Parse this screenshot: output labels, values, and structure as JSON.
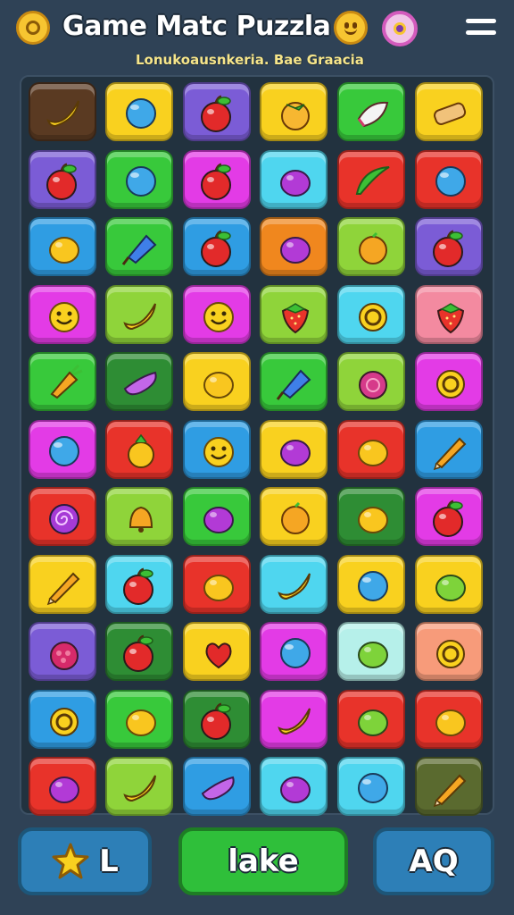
{
  "header": {
    "title": "Game  Matc Puzzla",
    "subtitle": "Lonukoausnkeria.  Bae  Graacia"
  },
  "buttons": {
    "left_label": "L",
    "middle_label": "lake",
    "right_label": "AQ"
  },
  "colors": {
    "red": "#e8332a",
    "green": "#38c93b",
    "blue": "#2f9de3",
    "yellow": "#f9d11f",
    "purple": "#7b5cd6",
    "magenta": "#e33be6",
    "orange": "#f0871e",
    "cyan": "#4fd6ef",
    "brown": "#5a3a22",
    "lime": "#8fd43a",
    "darkgreen": "#2e8d34",
    "pink": "#f38aa0",
    "lightcyan": "#b6f0ea",
    "salmon": "#f79b7a",
    "olive": "#5a6a2f"
  },
  "grid": {
    "rows": [
      [
        {
          "bg": "brown",
          "icon": "banana"
        },
        {
          "bg": "yellow",
          "icon": "ball"
        },
        {
          "bg": "purple",
          "icon": "apple"
        },
        {
          "bg": "yellow",
          "icon": "tomato"
        },
        {
          "bg": "green",
          "icon": "radish"
        },
        {
          "bg": "yellow",
          "icon": "roll"
        }
      ],
      [
        {
          "bg": "purple",
          "icon": "apple"
        },
        {
          "bg": "green",
          "icon": "ball"
        },
        {
          "bg": "magenta",
          "icon": "apple"
        },
        {
          "bg": "cyan",
          "icon": "plum"
        },
        {
          "bg": "red",
          "icon": "leaf"
        },
        {
          "bg": "red",
          "icon": "ball"
        }
      ],
      [
        {
          "bg": "blue",
          "icon": "lemon"
        },
        {
          "bg": "green",
          "icon": "candy"
        },
        {
          "bg": "blue",
          "icon": "apple"
        },
        {
          "bg": "orange",
          "icon": "plum"
        },
        {
          "bg": "lime",
          "icon": "orange"
        },
        {
          "bg": "purple",
          "icon": "apple"
        }
      ],
      [
        {
          "bg": "magenta",
          "icon": "smiley"
        },
        {
          "bg": "lime",
          "icon": "banana"
        },
        {
          "bg": "magenta",
          "icon": "smiley"
        },
        {
          "bg": "lime",
          "icon": "strawberry"
        },
        {
          "bg": "cyan",
          "icon": "ring"
        },
        {
          "bg": "pink",
          "icon": "strawberry"
        }
      ],
      [
        {
          "bg": "green",
          "icon": "carrot"
        },
        {
          "bg": "darkgreen",
          "icon": "eggplant"
        },
        {
          "bg": "yellow",
          "icon": "lemon"
        },
        {
          "bg": "green",
          "icon": "candy"
        },
        {
          "bg": "lime",
          "icon": "berry"
        },
        {
          "bg": "magenta",
          "icon": "ring"
        }
      ],
      [
        {
          "bg": "magenta",
          "icon": "ball"
        },
        {
          "bg": "red",
          "icon": "pineapple"
        },
        {
          "bg": "blue",
          "icon": "smiley"
        },
        {
          "bg": "yellow",
          "icon": "plum"
        },
        {
          "bg": "red",
          "icon": "lemon"
        },
        {
          "bg": "blue",
          "icon": "pencil"
        }
      ],
      [
        {
          "bg": "red",
          "icon": "swirl"
        },
        {
          "bg": "lime",
          "icon": "bell"
        },
        {
          "bg": "green",
          "icon": "plum"
        },
        {
          "bg": "yellow",
          "icon": "orange"
        },
        {
          "bg": "darkgreen",
          "icon": "lemon"
        },
        {
          "bg": "magenta",
          "icon": "apple"
        }
      ],
      [
        {
          "bg": "yellow",
          "icon": "pencil"
        },
        {
          "bg": "cyan",
          "icon": "apple"
        },
        {
          "bg": "red",
          "icon": "lemon"
        },
        {
          "bg": "cyan",
          "icon": "banana"
        },
        {
          "bg": "yellow",
          "icon": "ball"
        },
        {
          "bg": "yellow",
          "icon": "lime"
        }
      ],
      [
        {
          "bg": "purple",
          "icon": "raspberry"
        },
        {
          "bg": "darkgreen",
          "icon": "apple"
        },
        {
          "bg": "yellow",
          "icon": "heartapple"
        },
        {
          "bg": "magenta",
          "icon": "ball"
        },
        {
          "bg": "lightcyan",
          "icon": "lime"
        },
        {
          "bg": "salmon",
          "icon": "ring"
        }
      ],
      [
        {
          "bg": "blue",
          "icon": "ring"
        },
        {
          "bg": "green",
          "icon": "lemon"
        },
        {
          "bg": "darkgreen",
          "icon": "apple"
        },
        {
          "bg": "magenta",
          "icon": "banana"
        },
        {
          "bg": "red",
          "icon": "lime"
        },
        {
          "bg": "red",
          "icon": "lemon"
        }
      ],
      [
        {
          "bg": "red",
          "icon": "plum"
        },
        {
          "bg": "lime",
          "icon": "banana"
        },
        {
          "bg": "blue",
          "icon": "eggplant"
        },
        {
          "bg": "cyan",
          "icon": "plum"
        },
        {
          "bg": "cyan",
          "icon": "ball"
        },
        {
          "bg": "olive",
          "icon": "pencil"
        }
      ]
    ]
  }
}
